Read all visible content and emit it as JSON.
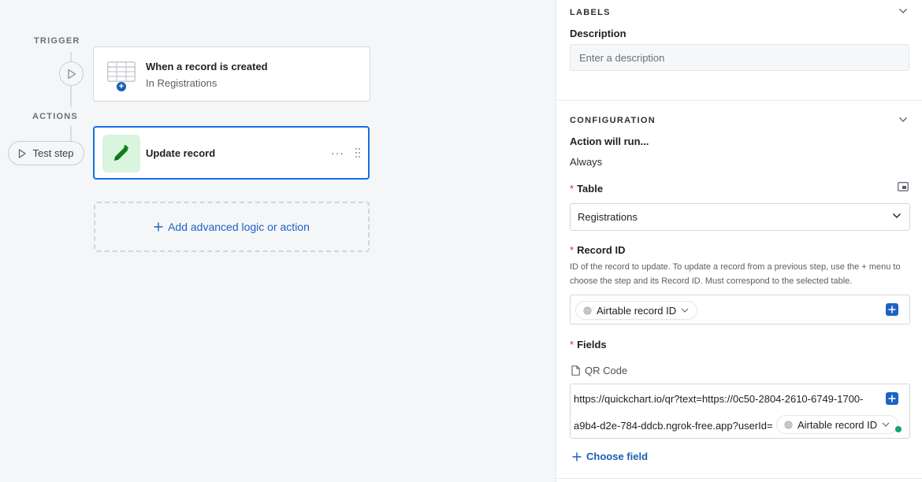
{
  "canvas": {
    "trigger_label": "TRIGGER",
    "actions_label": "ACTIONS",
    "test_step_label": "Test step",
    "trigger_card": {
      "title": "When a record is created",
      "subtitle": "In Registrations",
      "icon": "table-icon"
    },
    "action_card": {
      "title": "Update record",
      "menu": "···",
      "icon": "pencil-icon"
    },
    "add_step_label": "Add advanced logic or action"
  },
  "panel": {
    "labels_section": {
      "heading": "LABELS",
      "description_label": "Description",
      "description_placeholder": "Enter a description",
      "description_value": ""
    },
    "configuration_section": {
      "heading": "CONFIGURATION",
      "action_runs_label": "Action will run...",
      "action_runs_value": "Always",
      "table_label": "Table",
      "table_value": "Registrations",
      "record_id_label": "Record ID",
      "record_id_help": "ID of the record to update. To update a record from a previous step, use the + menu to choose the step and its Record ID. Must correspond to the selected table.",
      "record_id_token": "Airtable record ID",
      "fields_label": "Fields",
      "field_name": "QR Code",
      "field_value_line1": "https://quickchart.io/qr?text=https://0c50-2804-2610-6749-1700-",
      "field_value_line2": "a9b4-d2e-784-ddcb.ngrok-free.app?userId=",
      "field_value_token": "Airtable record ID",
      "choose_field_label": "Choose field",
      "required_mark": "*"
    }
  },
  "colors": {
    "accent": "#166ee1",
    "link": "#1b63c6",
    "required": "#d32f2f",
    "pencil_bg": "#d9f5dd",
    "pencil": "#0d7f1a",
    "status_dot": "#14a07a"
  }
}
